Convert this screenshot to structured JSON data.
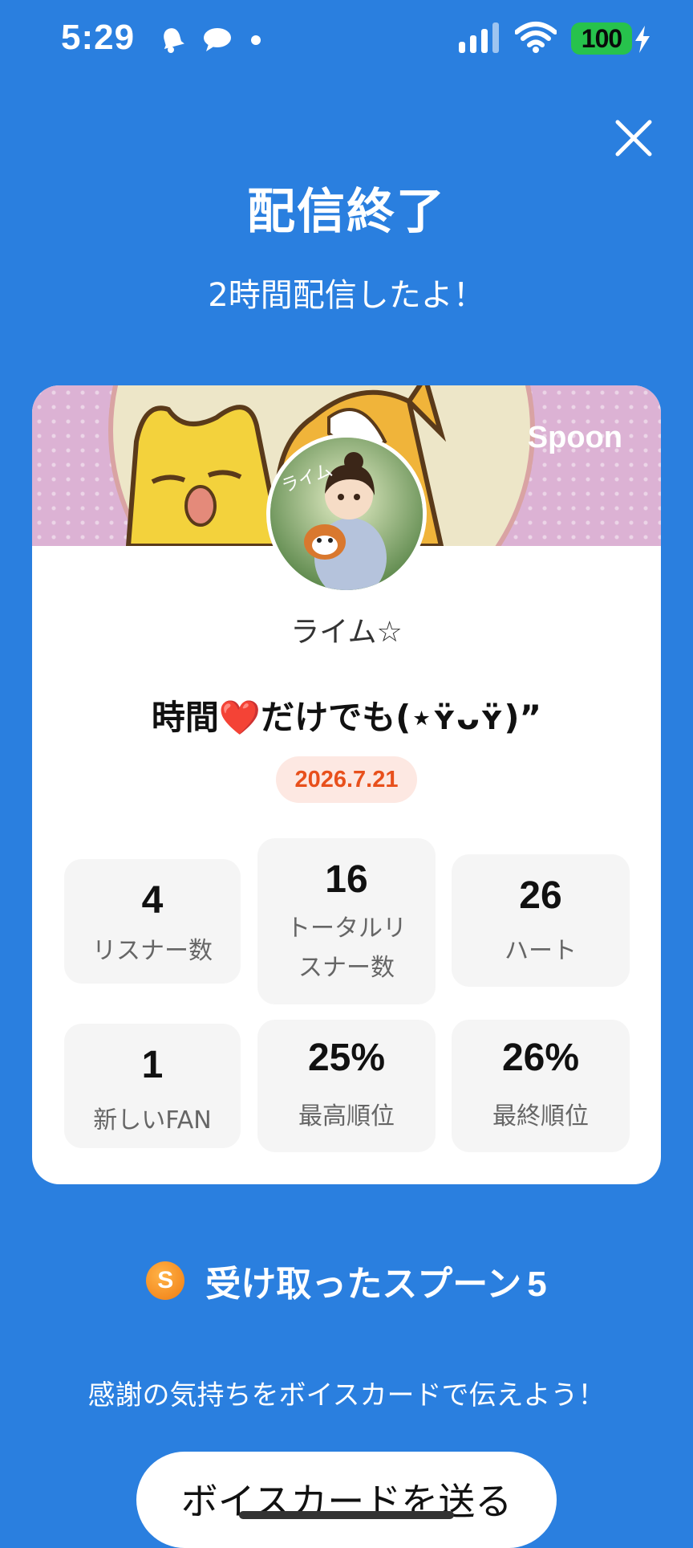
{
  "status_bar": {
    "time": "5:29",
    "battery": "100",
    "left_icons": [
      "bell-icon",
      "chat-bubble-icon",
      "dot-icon"
    ],
    "right_icons": [
      "signal-bars-icon",
      "wifi-icon",
      "battery-icon",
      "charging-bolt-icon"
    ]
  },
  "header": {
    "title": "配信終了",
    "subtitle": "2時間配信したよ！",
    "close_icon": "close-icon"
  },
  "card": {
    "brand": "Spoon",
    "username": "ライム☆",
    "broadcast_title": "時間❤️だけでも(⋆ʏ̈ᴗʏ̈)”",
    "date": "2026.7.21",
    "stats": [
      {
        "value": "4",
        "label": "リスナー数"
      },
      {
        "value": "16",
        "label_line1": "トータルリ",
        "label_line2": "スナー数"
      },
      {
        "value": "26",
        "label": "ハート"
      },
      {
        "value": "1",
        "label": "新しいFAN"
      },
      {
        "value": "25%",
        "label": "最高順位"
      },
      {
        "value": "26%",
        "label": "最終順位"
      }
    ]
  },
  "spoons": {
    "coin_letter": "S",
    "label": "受け取ったスプーン",
    "count": "5"
  },
  "thanks_text": "感謝の気持ちをボイスカードで伝えよう！",
  "send_button": "ボイスカードを送る",
  "colors": {
    "background": "#2a7fdf",
    "card": "#ffffff",
    "stat_box": "#f5f5f5",
    "date_text": "#e8501c",
    "date_badge": "#fde8e2",
    "battery": "#27c24c",
    "coin": "#f08a1c"
  }
}
